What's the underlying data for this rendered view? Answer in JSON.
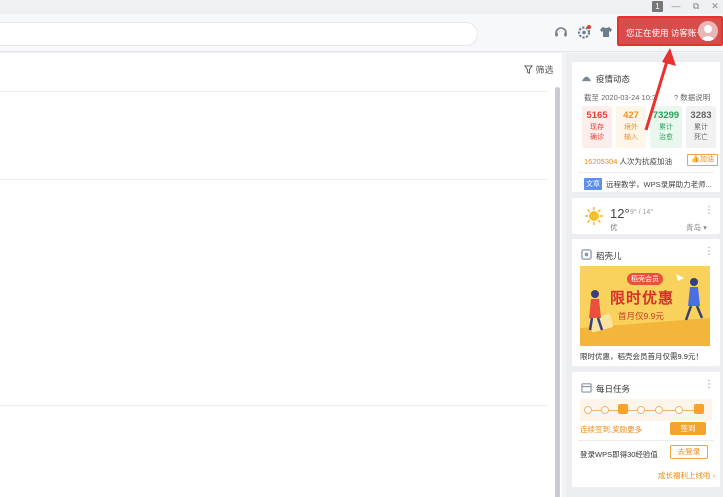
{
  "window": {
    "badge": "1",
    "min_glyph": "—",
    "restore_glyph": "⧉",
    "close_glyph": "✕"
  },
  "toolbar": {
    "login_prefix": "您正在使用",
    "login_account": "访客账号"
  },
  "main": {
    "filter_label": "筛选"
  },
  "covid": {
    "title": "疫情动态",
    "date": "截至 2020-03-24 10:3",
    "help": "数据说明",
    "stats": [
      {
        "value": "5165",
        "label_1": "现存",
        "label_2": "确诊",
        "color": "#e6403a",
        "bg": "#fdeeee"
      },
      {
        "value": "427",
        "label_1": "境外",
        "label_2": "输入",
        "color": "#f0922a",
        "bg": "#fff6ea"
      },
      {
        "value": "73299",
        "label_1": "累计",
        "label_2": "治愈",
        "color": "#2aa25a",
        "bg": "#eaf7ef"
      },
      {
        "value": "3283",
        "label_1": "累计",
        "label_2": "死亡",
        "color": "#666666",
        "bg": "#f2f2f2"
      }
    ],
    "cheer_count": "16205304",
    "cheer_text": " 人次为抗疫加油",
    "cheer_button": "加油",
    "news_tag": "文章",
    "news_text": "远程教学，WPS录屏助力老师..."
  },
  "weather": {
    "temp": "12°",
    "range": "9° / 14°",
    "air": "优",
    "city": "青岛"
  },
  "docer": {
    "title": "稻壳儿",
    "promo_badge": "稻壳会员",
    "promo_big": "限时优惠",
    "promo_small": "首月仅9.9元",
    "caption": "限时优惠，稻壳会员首月仅需9.9元！"
  },
  "tasks": {
    "title": "每日任务",
    "sign_text": "连续签到,奖励更多",
    "sign_button": "签到",
    "task_text": "登录WPS即得30经验值",
    "task_button": "去登录",
    "growth_link": "成长福利上线啦 ›"
  }
}
